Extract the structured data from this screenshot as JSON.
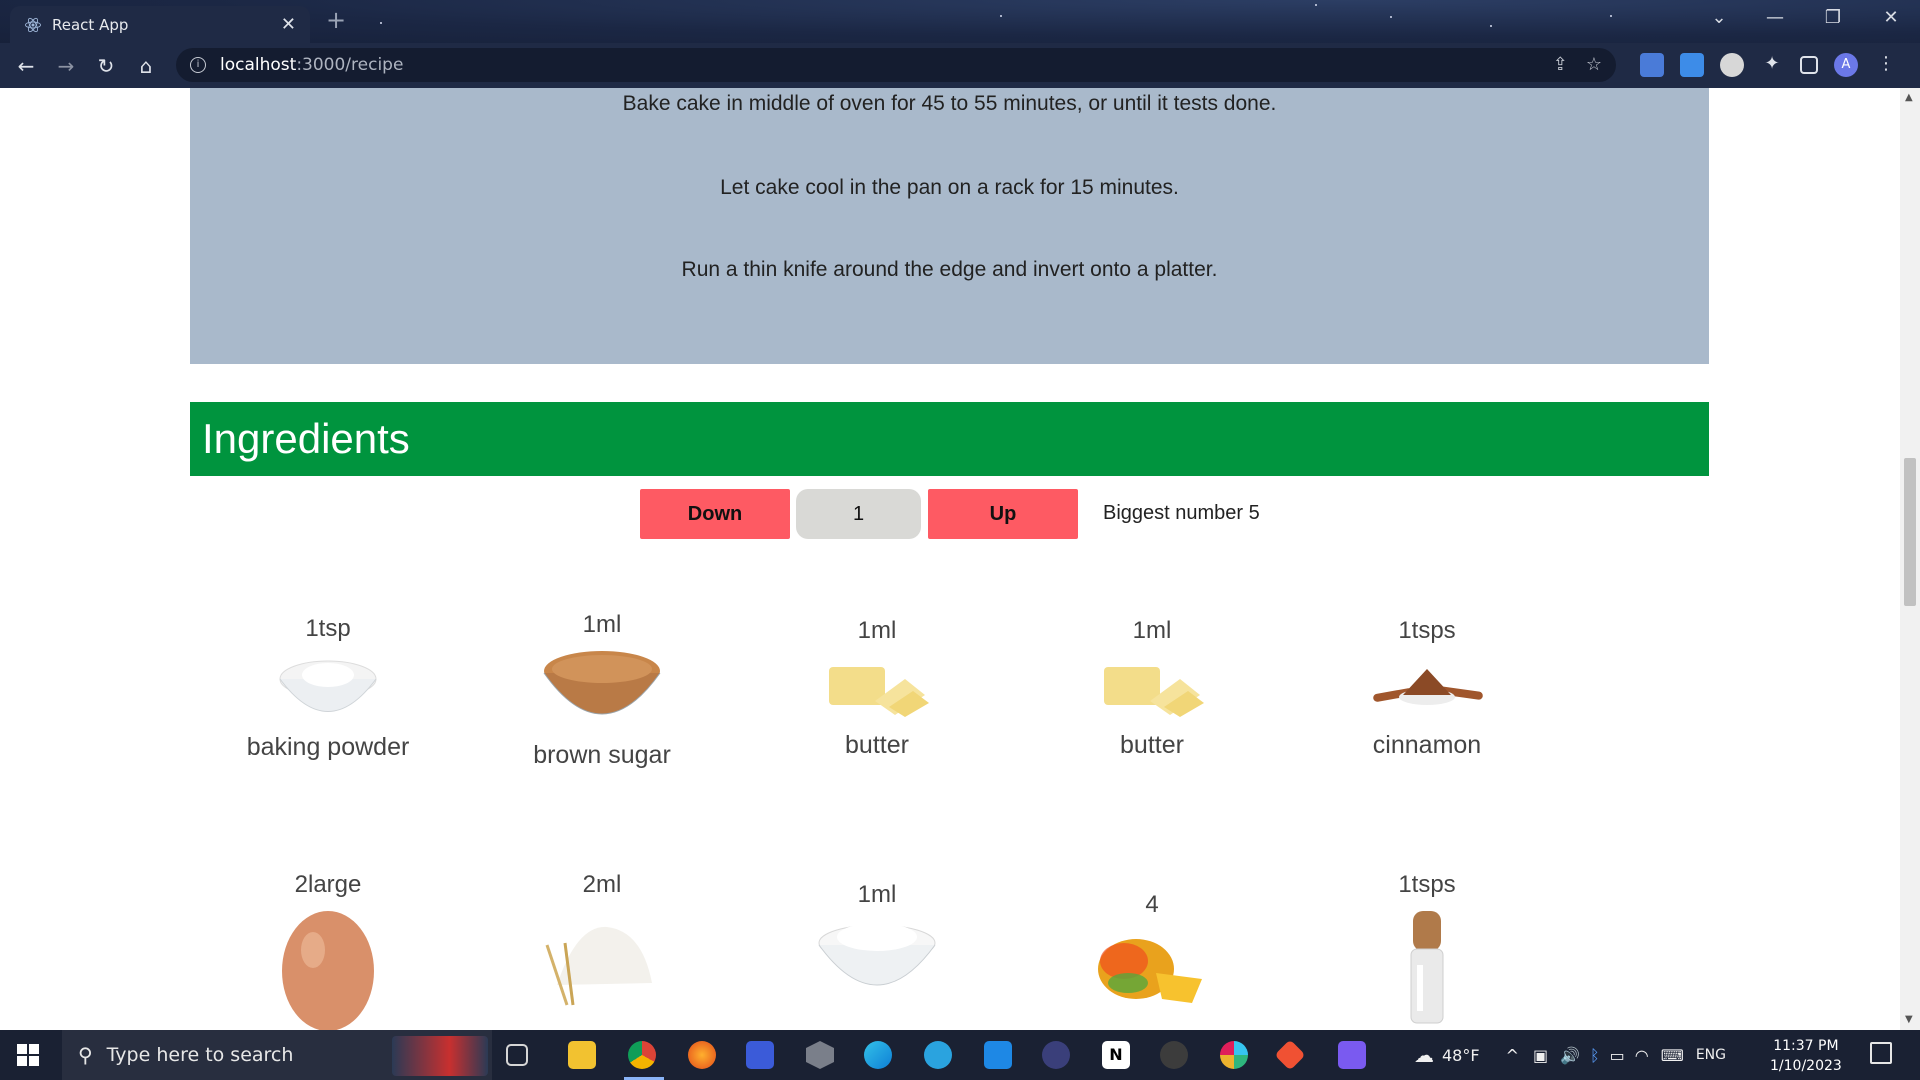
{
  "browser": {
    "tab_title": "React App",
    "new_tab_symbol": "+",
    "url_host": "localhost",
    "url_path": ":3000/recipe",
    "profile_initial": "A"
  },
  "instructions": [
    "Bake cake in middle of oven for 45 to 55 minutes, or until it tests done.",
    "Let cake cool in the pan on a rack for 15 minutes.",
    "Run a thin knife around the edge and invert onto a platter."
  ],
  "ingredients_section": {
    "title": "Ingredients",
    "down_label": "Down",
    "value": "1",
    "up_label": "Up",
    "biggest_label": "Biggest number 5"
  },
  "ingredients": [
    {
      "qty": "1tsp",
      "name": "baking powder",
      "icon": "powder-bowl-icon"
    },
    {
      "qty": "1ml",
      "name": "brown sugar",
      "icon": "sugar-bowl-icon"
    },
    {
      "qty": "1ml",
      "name": "butter",
      "icon": "butter-icon"
    },
    {
      "qty": "1ml",
      "name": "butter",
      "icon": "butter-icon"
    },
    {
      "qty": "1tsps",
      "name": "cinnamon",
      "icon": "cinnamon-icon"
    },
    {
      "qty": "2large",
      "name": "",
      "icon": "egg-icon"
    },
    {
      "qty": "2ml",
      "name": "",
      "icon": "flour-icon"
    },
    {
      "qty": "1ml",
      "name": "",
      "icon": "salt-bowl-icon"
    },
    {
      "qty": "4",
      "name": "",
      "icon": "mango-icon"
    },
    {
      "qty": "1tsps",
      "name": "",
      "icon": "grinder-icon"
    }
  ],
  "taskbar": {
    "search_placeholder": "Type here to search",
    "weather": "48°F",
    "language": "ENG",
    "time": "11:37 PM",
    "date": "1/10/2023"
  }
}
